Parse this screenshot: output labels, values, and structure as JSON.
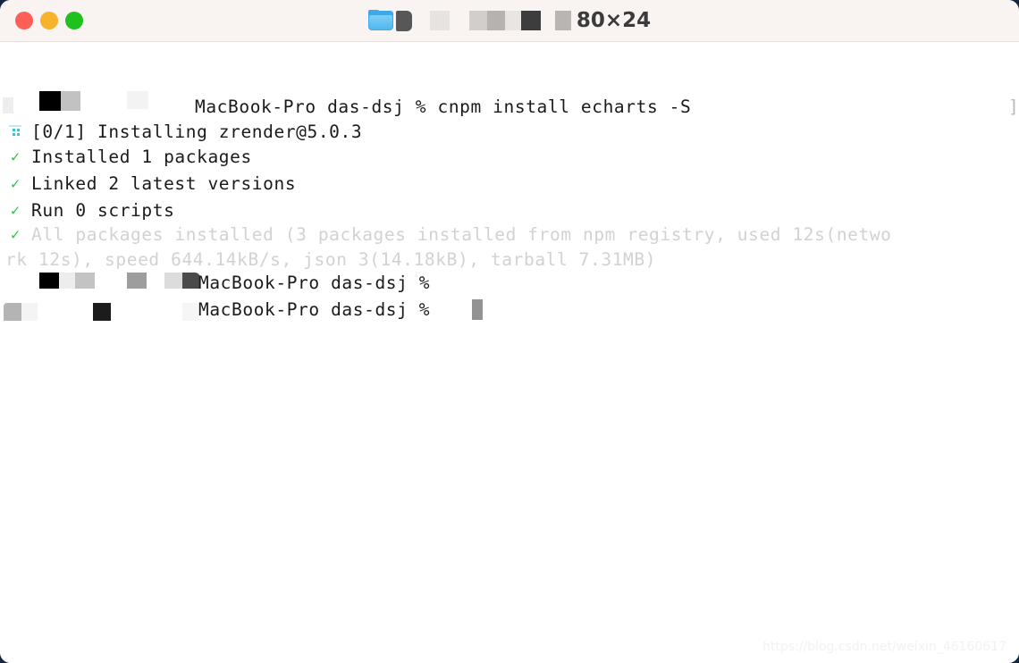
{
  "window": {
    "title_size": "80×24",
    "traffic_lights": [
      {
        "name": "close",
        "color": "#ff5f57"
      },
      {
        "name": "minimize",
        "color": "#f7b32b"
      },
      {
        "name": "maximize",
        "color": "#1ec11e"
      }
    ],
    "folder_icon": "folder-icon",
    "background": "#ffffff",
    "titlebar_background": "#f9f4f1",
    "desktop_background": "#16263f"
  },
  "terminal": {
    "right_edge_bracket": "]",
    "lines": [
      {
        "id": "cmd-line",
        "gutter": "none",
        "text": "MacBook-Pro das-dsj % cnpm install echarts -S",
        "style": "normal"
      },
      {
        "id": "installing-line",
        "gutter": "download-icon",
        "text": "[0/1] Installing zrender@5.0.3",
        "style": "normal"
      },
      {
        "id": "installed-line",
        "gutter": "check",
        "text": "Installed 1 packages",
        "style": "normal"
      },
      {
        "id": "linked-line",
        "gutter": "check",
        "text": "Linked 2 latest versions",
        "style": "normal"
      },
      {
        "id": "scripts-line",
        "gutter": "check",
        "text": "Run 0 scripts",
        "style": "normal"
      },
      {
        "id": "summary-line-1",
        "gutter": "check",
        "text": "All packages installed (3 packages installed from npm registry, used 12s(netwo",
        "style": "dim"
      },
      {
        "id": "summary-line-2",
        "gutter": "none",
        "text": "rk 12s), speed 644.14kB/s, json 3(14.18kB), tarball 7.31MB)",
        "style": "dim"
      },
      {
        "id": "prompt-line-1",
        "gutter": "none",
        "text": "MacBook-Pro das-dsj %",
        "style": "normal"
      },
      {
        "id": "prompt-line-2",
        "gutter": "none",
        "text": "MacBook-Pro das-dsj %",
        "style": "normal"
      }
    ]
  },
  "watermark": {
    "text": "https://blog.csdn.net/weixin_46160617"
  }
}
